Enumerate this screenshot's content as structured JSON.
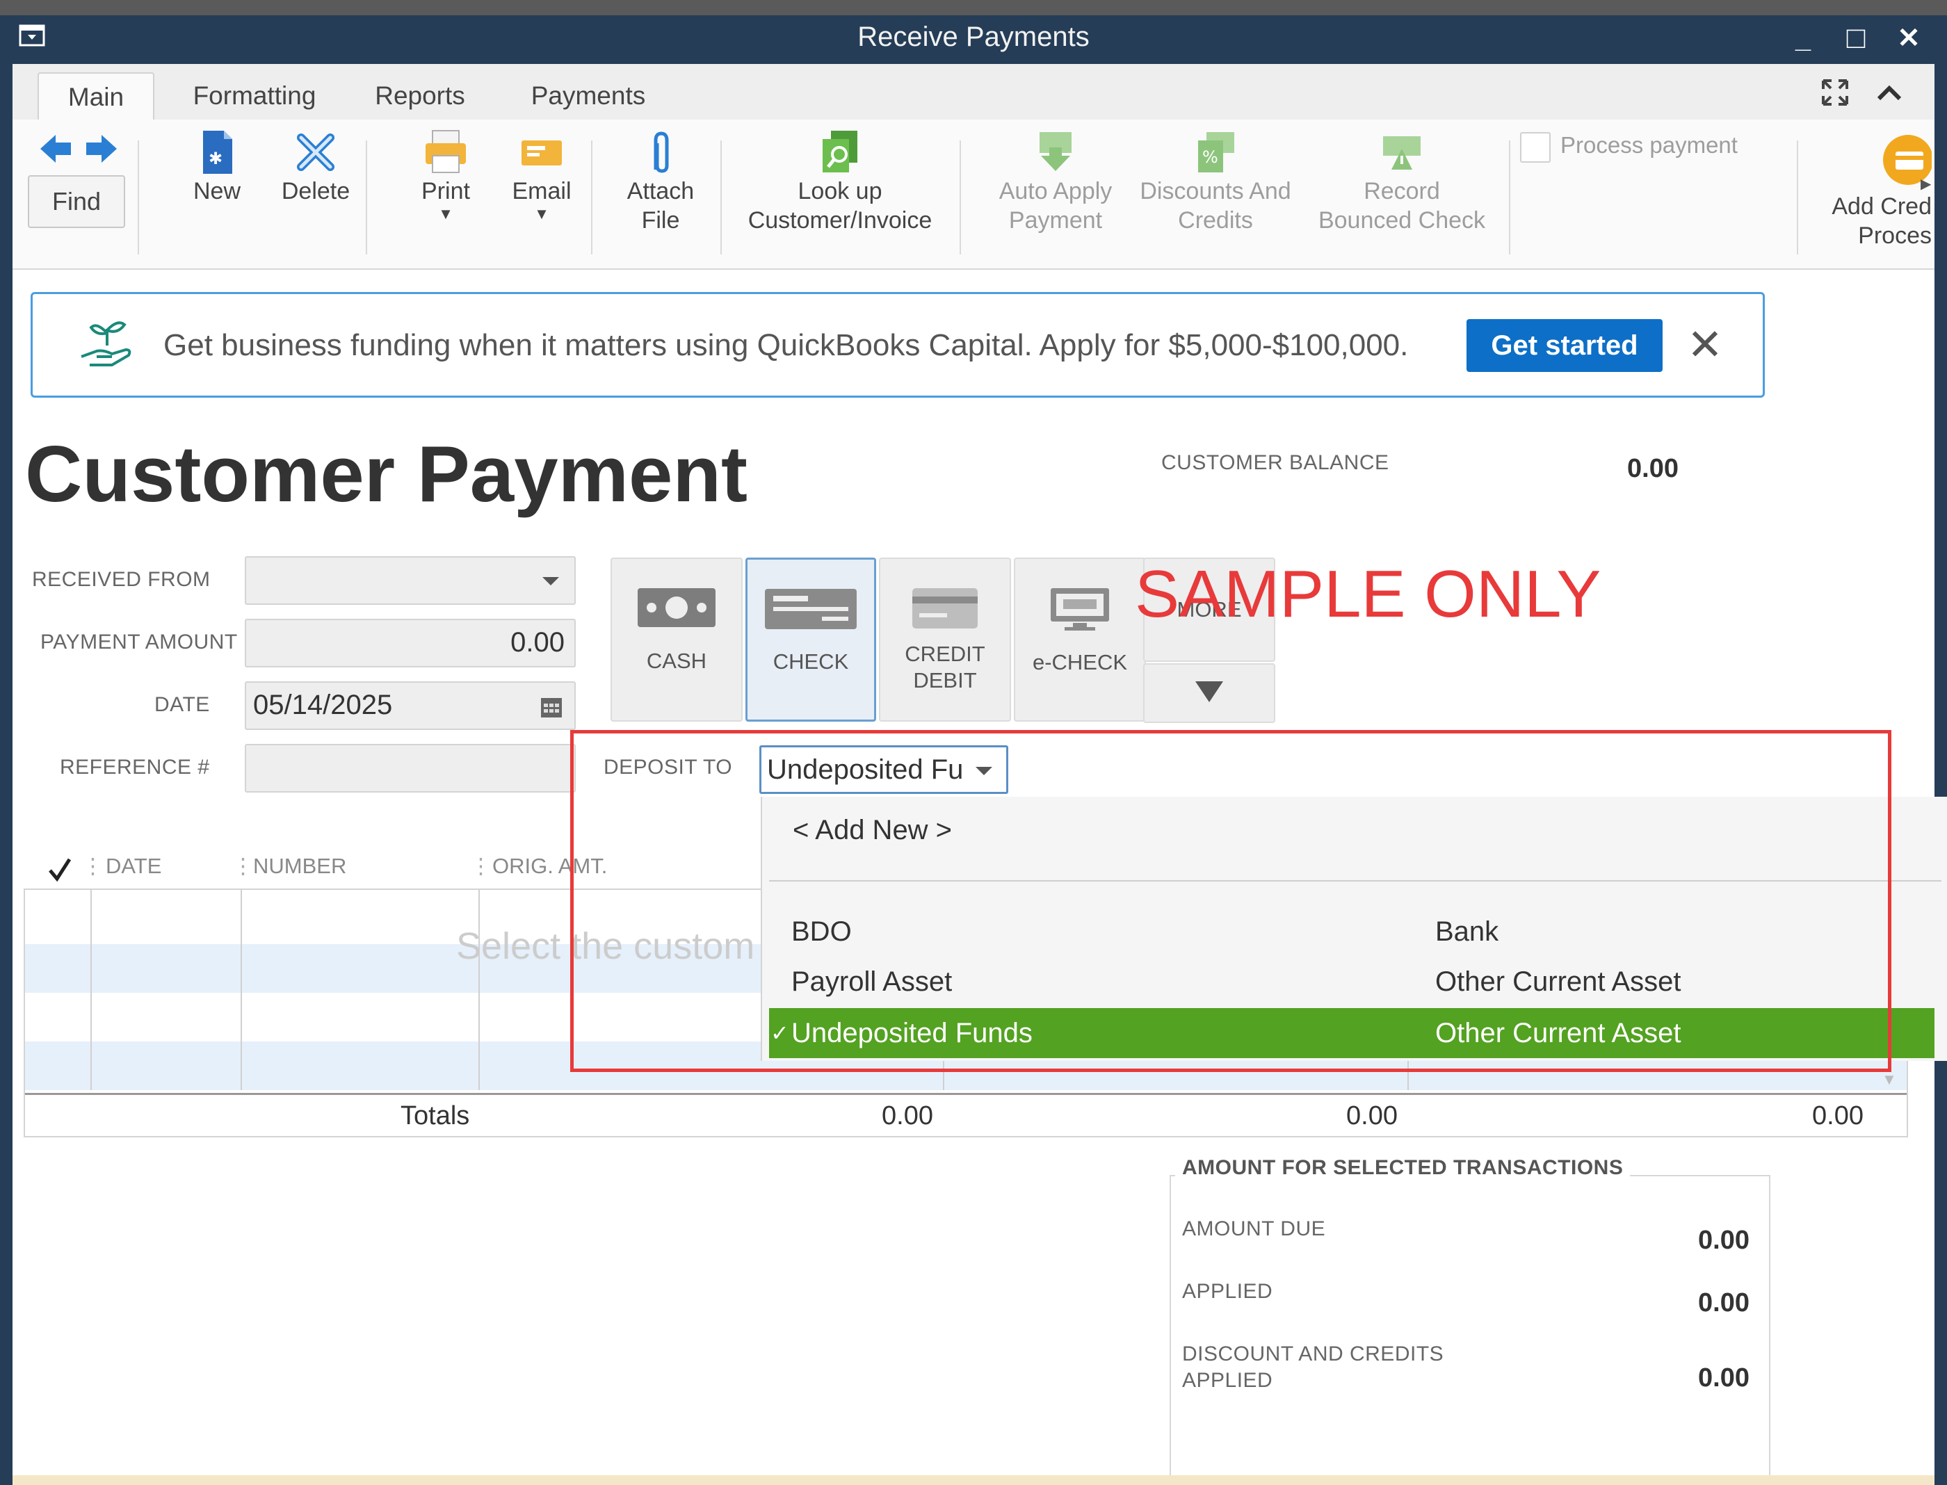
{
  "window": {
    "title": "Receive Payments",
    "controls": {
      "minimize": "_",
      "maximize": "□",
      "close": "✕"
    }
  },
  "tabs": [
    {
      "label": "Main",
      "active": true
    },
    {
      "label": "Formatting",
      "active": false
    },
    {
      "label": "Reports",
      "active": false
    },
    {
      "label": "Payments",
      "active": false
    }
  ],
  "toolbar": {
    "find": "Find",
    "new": "New",
    "delete": "Delete",
    "print": "Print",
    "email": "Email",
    "attach_line1": "Attach",
    "attach_line2": "File",
    "lookup_line1": "Look up",
    "lookup_line2": "Customer/Invoice",
    "autoapply_line1": "Auto Apply",
    "autoapply_line2": "Payment",
    "discounts_line1": "Discounts And",
    "discounts_line2": "Credits",
    "bounced_line1": "Record",
    "bounced_line2": "Bounced Check",
    "process_payment": "Process payment",
    "addcred_line1": "Add Cred",
    "addcred_line2": "Proces"
  },
  "banner": {
    "text": "Get business funding when it matters using QuickBooks Capital. Apply for $5,000-$100,000.",
    "button": "Get started",
    "close": "✕"
  },
  "page": {
    "heading": "Customer Payment",
    "customer_balance_label": "CUSTOMER BALANCE",
    "customer_balance": "0.00"
  },
  "form": {
    "received_from_label": "RECEIVED FROM",
    "received_from_value": "",
    "payment_amount_label": "PAYMENT AMOUNT",
    "payment_amount": "0.00",
    "date_label": "DATE",
    "date": "05/14/2025",
    "reference_label": "REFERENCE #",
    "reference": "",
    "deposit_to_label": "DEPOSIT TO",
    "deposit_to_value": "Undeposited Fu"
  },
  "payment_methods": [
    {
      "line1": "CASH",
      "line2": "",
      "selected": false
    },
    {
      "line1": "CHECK",
      "line2": "",
      "selected": true
    },
    {
      "line1": "CREDIT",
      "line2": "DEBIT",
      "selected": false
    },
    {
      "line1": "e-CHECK",
      "line2": "",
      "selected": false
    },
    {
      "line1": "MORE",
      "line2": "",
      "selected": false
    }
  ],
  "watermark": "SAMPLE ONLY",
  "dropdown": {
    "add_new": "< Add New >",
    "items": [
      {
        "name": "BDO",
        "type": "Bank",
        "selected": false
      },
      {
        "name": "Payroll Asset",
        "type": "Other Current Asset",
        "selected": false
      },
      {
        "name": "Undeposited Funds",
        "type": "Other Current Asset",
        "selected": true
      }
    ],
    "check": "✓"
  },
  "table": {
    "columns": [
      "✓",
      "DATE",
      "NUMBER",
      "ORIG. AMT."
    ],
    "placeholder": "Select the custom",
    "totals_label": "Totals",
    "totals": [
      "0.00",
      "0.00",
      "0.00"
    ]
  },
  "summary": {
    "title": "AMOUNT FOR SELECTED TRANSACTIONS",
    "amount_due_label": "AMOUNT DUE",
    "amount_due": "0.00",
    "applied_label": "APPLIED",
    "applied": "0.00",
    "discount_label_line1": "DISCOUNT AND CREDITS",
    "discount_label_line2": "APPLIED",
    "discount": "0.00"
  },
  "colors": {
    "titlebar": "#253d57",
    "accent_blue": "#0d6fc7",
    "selection_green": "#53a221",
    "watermark_red": "#e83a3a"
  }
}
